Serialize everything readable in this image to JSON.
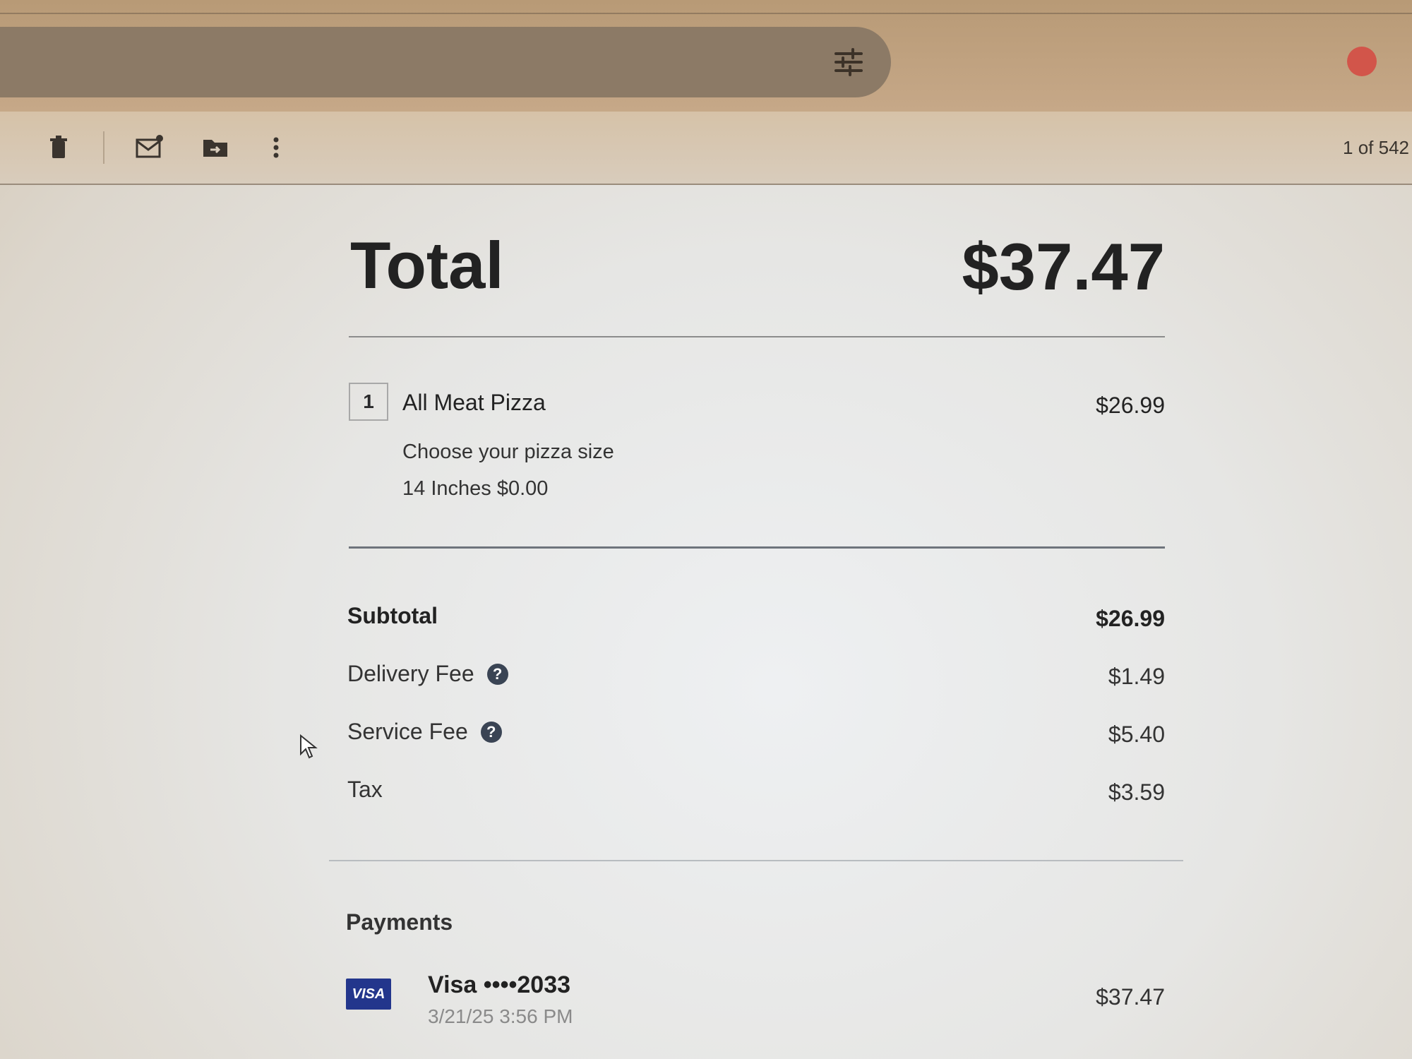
{
  "toolbar": {
    "pager": "1 of 542",
    "icons": [
      "delete-icon",
      "mark-unread-icon",
      "move-to-folder-icon",
      "more-options-icon"
    ]
  },
  "receipt": {
    "total_label": "Total",
    "total_value": "$37.47",
    "items": [
      {
        "qty": "1",
        "name": "All Meat Pizza",
        "price": "$26.99",
        "option_title": "Choose your pizza size",
        "option_value": "14 Inches $0.00"
      }
    ],
    "summary": {
      "subtotal_label": "Subtotal",
      "subtotal_value": "$26.99",
      "delivery_label": "Delivery Fee",
      "delivery_value": "$1.49",
      "service_label": "Service Fee",
      "service_value": "$5.40",
      "tax_label": "Tax",
      "tax_value": "$3.59"
    },
    "payments": {
      "title": "Payments",
      "card_brand": "VISA",
      "card_name": "Visa ••••2033",
      "card_date": "3/21/25 3:56 PM",
      "amount": "$37.47"
    }
  },
  "colors": {
    "visa_blue": "#23368c",
    "help_icon": "#3a4454",
    "avatar": "#d2554a"
  }
}
